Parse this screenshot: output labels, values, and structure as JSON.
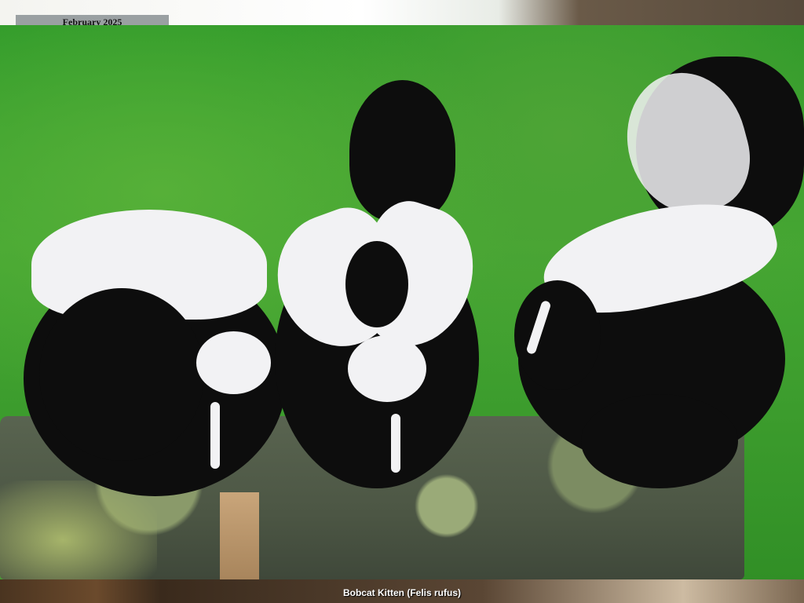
{
  "calendar": {
    "month_label": "February 2025"
  },
  "photo": {
    "subject": "skunks-on-log",
    "dominant_colors": [
      "#3c9c2d",
      "#0d0d0d",
      "#f2f2f4",
      "#4c5644"
    ]
  },
  "caption": {
    "text": "Bobcat Kitten (Felis rufus)"
  }
}
